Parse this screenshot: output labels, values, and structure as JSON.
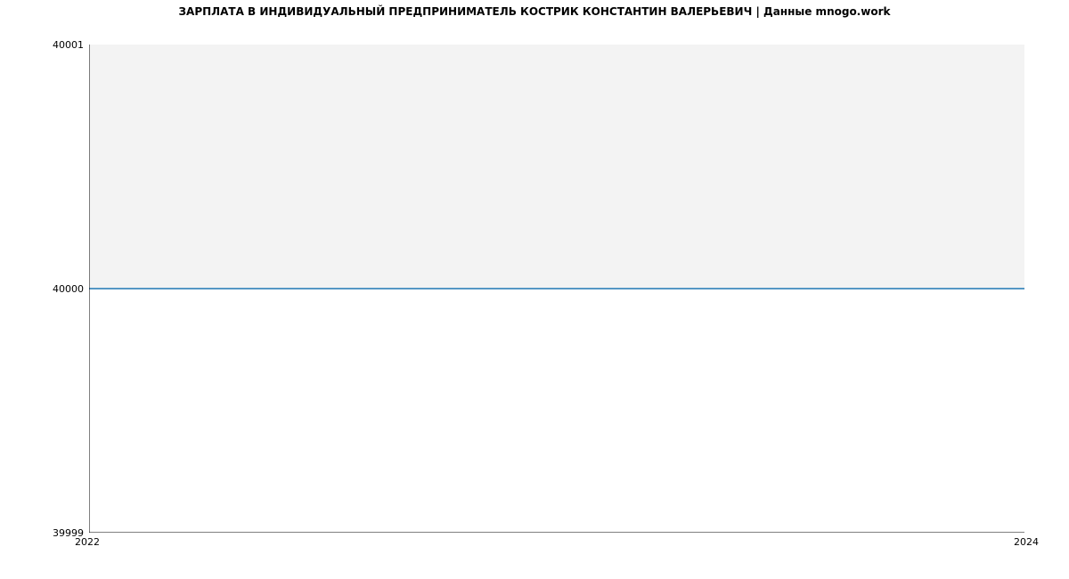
{
  "chart_data": {
    "type": "line",
    "title": "ЗАРПЛАТА В ИНДИВИДУАЛЬНЫЙ ПРЕДПРИНИМАТЕЛЬ КОСТРИК КОНСТАНТИН ВАЛЕРЬЕВИЧ | Данные mnogo.work",
    "xlabel": "",
    "ylabel": "",
    "x": [
      2022,
      2024
    ],
    "series": [
      {
        "name": "salary",
        "values": [
          40000,
          40000
        ],
        "color": "#1f77b4"
      }
    ],
    "xlim": [
      2022,
      2024
    ],
    "ylim": [
      39999,
      40001
    ],
    "xticks": [
      2022,
      2024
    ],
    "yticks": [
      39999,
      40000,
      40001
    ],
    "fill_under": true,
    "fill_color": "#f3f3f3"
  }
}
